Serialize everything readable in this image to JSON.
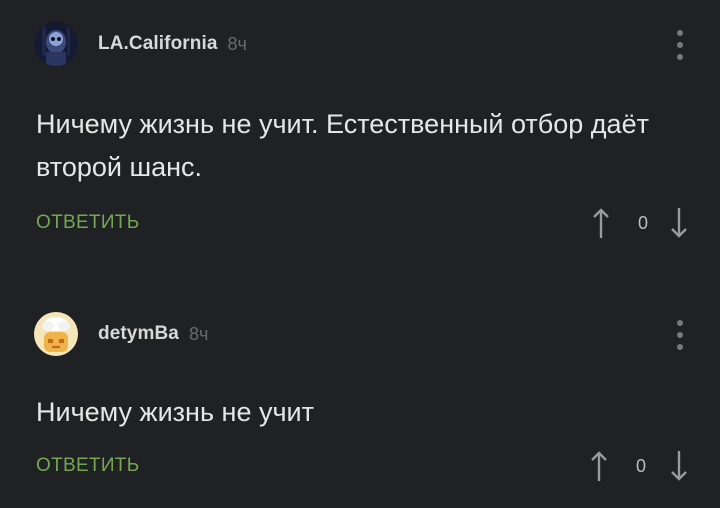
{
  "comments": [
    {
      "username": "LA.California",
      "time": "8ч",
      "text": "Ничему жизнь не учит. Естественный отбор даёт второй шанс.",
      "reply_label": "ОТВЕТИТЬ",
      "score": "0",
      "avatar_icon": "dark-robot-avatar"
    },
    {
      "username": "detymBa",
      "time": "8ч",
      "text": "Ничему жизнь не учит",
      "reply_label": "ОТВЕТИТЬ",
      "score": "0",
      "avatar_icon": "smoking-head-avatar"
    }
  ],
  "icons": {
    "more": "more-vertical-icon",
    "upvote": "arrow-up-icon",
    "downvote": "arrow-down-icon"
  },
  "colors": {
    "background": "#202124",
    "reply": "#74a850",
    "text": "#e6e6e6",
    "muted": "#6a6a6a"
  }
}
